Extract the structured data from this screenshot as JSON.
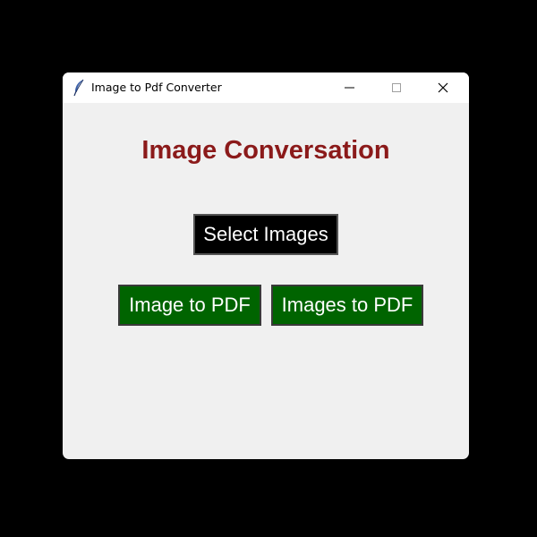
{
  "window": {
    "title": "Image to Pdf Converter",
    "app_icon": "feather-icon",
    "controls": {
      "minimize_icon": "minimize-icon",
      "maximize_icon": "maximize-icon",
      "close_icon": "close-icon"
    }
  },
  "main": {
    "heading": "Image Conversation",
    "select_button_label": "Select Images",
    "image_to_pdf_label": "Image to PDF",
    "images_to_pdf_label": "Images to PDF"
  },
  "colors": {
    "background": "#000000",
    "window_bg": "#f0f0f0",
    "heading": "#8b1a1a",
    "select_button_bg": "#000000",
    "green_button_bg": "#006400",
    "button_text": "#ffffff"
  }
}
